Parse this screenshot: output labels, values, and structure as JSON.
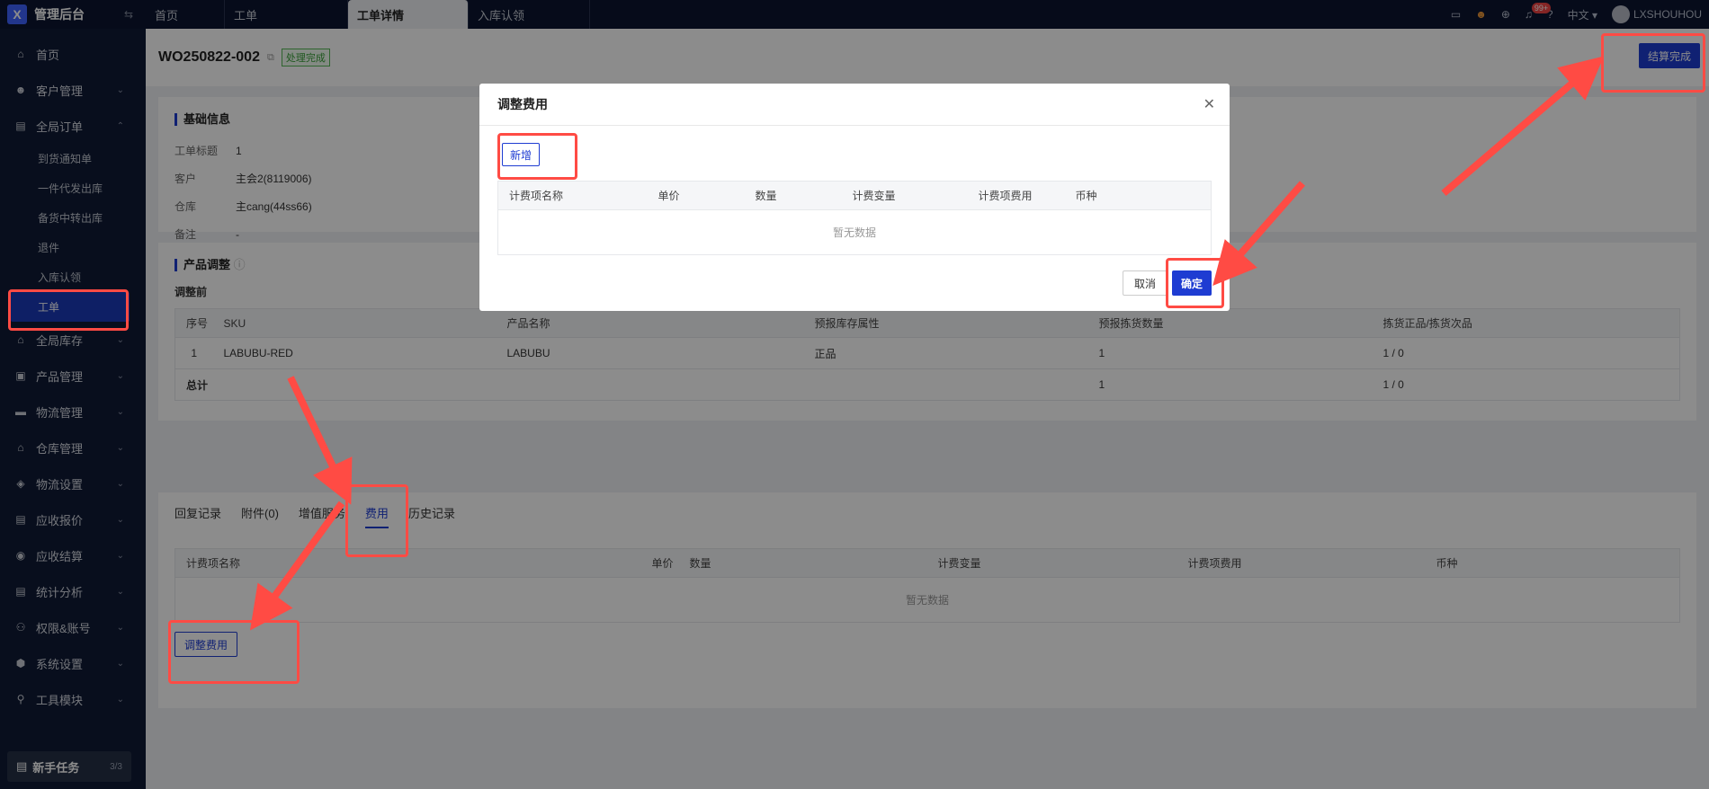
{
  "app": {
    "title": "管理后台",
    "logo": "X"
  },
  "tabs": [
    {
      "label": "首页"
    },
    {
      "label": "工单"
    },
    {
      "label": "工单详情",
      "active": true
    },
    {
      "label": "入库认领"
    }
  ],
  "topright": {
    "notif_count": "99+",
    "lang": "中文",
    "user": "LXSHOUHOU"
  },
  "sidebar": {
    "items": [
      {
        "label": "首页",
        "icon": "home-icon"
      },
      {
        "label": "客户管理",
        "icon": "users-icon"
      },
      {
        "label": "全局订单",
        "icon": "clipboard-icon"
      },
      {
        "label": "全局库存",
        "icon": "warehouse-icon"
      },
      {
        "label": "产品管理",
        "icon": "box-icon"
      },
      {
        "label": "物流管理",
        "icon": "truck-icon"
      },
      {
        "label": "仓库管理",
        "icon": "store-icon"
      },
      {
        "label": "物流设置",
        "icon": "cube-icon"
      },
      {
        "label": "应收报价",
        "icon": "quote-icon"
      },
      {
        "label": "应收结算",
        "icon": "coin-icon"
      },
      {
        "label": "统计分析",
        "icon": "chart-icon"
      },
      {
        "label": "权限&账号",
        "icon": "org-icon"
      },
      {
        "label": "系统设置",
        "icon": "gear-icon"
      },
      {
        "label": "工具模块",
        "icon": "wrench-icon"
      }
    ],
    "sub_items": [
      "到货通知单",
      "一件代发出库",
      "备货中转出库",
      "退件",
      "入库认领",
      "工单"
    ],
    "task": {
      "label": "新手任务",
      "count": "3/3"
    }
  },
  "header": {
    "wo_no": "WO250822-002",
    "status": "处理完成",
    "settle_btn": "结算完成"
  },
  "basic": {
    "title": "基础信息",
    "rows": [
      {
        "k": "工单标题",
        "v": "1"
      },
      {
        "k": "客户",
        "v": "主会2(8119006)"
      },
      {
        "k": "仓库",
        "v": "主cang(44ss66)"
      },
      {
        "k": "备注",
        "v": "-"
      }
    ]
  },
  "product": {
    "title": "产品调整",
    "before": "调整前",
    "columns": [
      "序号",
      "SKU",
      "产品名称",
      "预报库存属性",
      "预报拣货数量",
      "拣货正品/拣货次品"
    ],
    "rows": [
      [
        "1",
        "LABUBU-RED",
        "LABUBU",
        "正品",
        "1",
        "1 / 0"
      ]
    ],
    "total": {
      "label": "总计",
      "qty": "1",
      "pick": "1 / 0"
    }
  },
  "fee_tabs": [
    "回复记录",
    "附件(0)",
    "增值服务",
    "费用",
    "历史记录"
  ],
  "fee": {
    "columns": [
      "计费项名称",
      "单价",
      "数量",
      "计费变量",
      "计费项费用",
      "币种"
    ],
    "empty": "暂无数据",
    "adjust_btn": "调整费用"
  },
  "modal": {
    "title": "调整费用",
    "add_btn": "新增",
    "columns": [
      "计费项名称",
      "单价",
      "数量",
      "计费变量",
      "计费项费用",
      "币种"
    ],
    "empty": "暂无数据",
    "cancel": "取消",
    "ok": "确定"
  },
  "colors": {
    "accent": "#1e3cd2",
    "sidebar": "#0f1a35",
    "annotation": "#ff4b44"
  }
}
